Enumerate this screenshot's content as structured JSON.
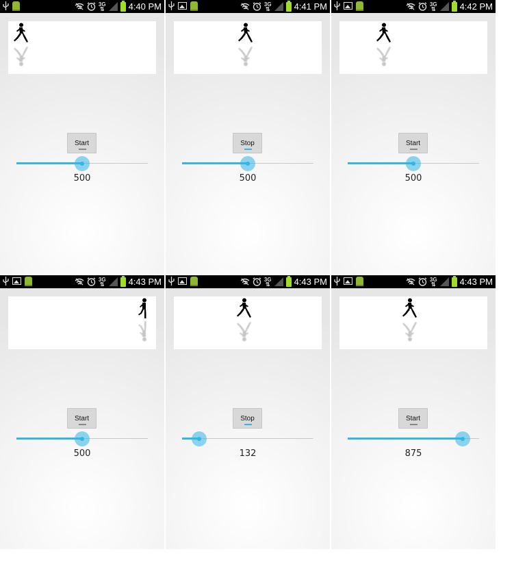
{
  "panels": [
    {
      "time": "4:40 PM",
      "button_label": "Start",
      "running": false,
      "seek_value": 500,
      "seek_max": 1000,
      "value_text": "500",
      "runner_position": 0.03,
      "runner_pose": "stride",
      "status_icons": [
        "usb-icon",
        "android-icon"
      ]
    },
    {
      "time": "4:41 PM",
      "button_label": "Stop",
      "running": true,
      "seek_value": 500,
      "seek_max": 1000,
      "value_text": "500",
      "runner_position": 0.48,
      "runner_pose": "stride",
      "status_icons": [
        "usb-icon",
        "image-icon",
        "android-icon"
      ]
    },
    {
      "time": "4:42 PM",
      "button_label": "Start",
      "running": false,
      "seek_value": 500,
      "seek_max": 1000,
      "value_text": "500",
      "runner_position": 0.27,
      "runner_pose": "stride",
      "status_icons": [
        "usb-icon",
        "image-icon",
        "android-icon"
      ]
    },
    {
      "time": "4:43 PM",
      "button_label": "Start",
      "running": false,
      "seek_value": 500,
      "seek_max": 1000,
      "value_text": "500",
      "runner_position": 0.96,
      "runner_pose": "upright",
      "status_icons": [
        "usb-icon",
        "image-icon",
        "android-icon"
      ]
    },
    {
      "time": "4:43 PM",
      "button_label": "Stop",
      "running": true,
      "seek_value": 132,
      "seek_max": 1000,
      "value_text": "132",
      "runner_position": 0.47,
      "runner_pose": "stride",
      "status_icons": [
        "usb-icon",
        "image-icon",
        "android-icon"
      ]
    },
    {
      "time": "4:43 PM",
      "button_label": "Start",
      "running": false,
      "seek_value": 875,
      "seek_max": 1000,
      "value_text": "875",
      "runner_position": 0.47,
      "runner_pose": "stride",
      "status_icons": [
        "usb-icon",
        "image-icon",
        "android-icon"
      ]
    }
  ],
  "status_right_icons": [
    "wifi-off-icon",
    "alarm-icon",
    "3g-icon",
    "signal-icon",
    "battery-icon"
  ],
  "network_label": "3G",
  "colors": {
    "accent": "#33b5e5",
    "statusbar": "#000000",
    "battery": "#a0dc28",
    "button": "#d8d8d8"
  }
}
